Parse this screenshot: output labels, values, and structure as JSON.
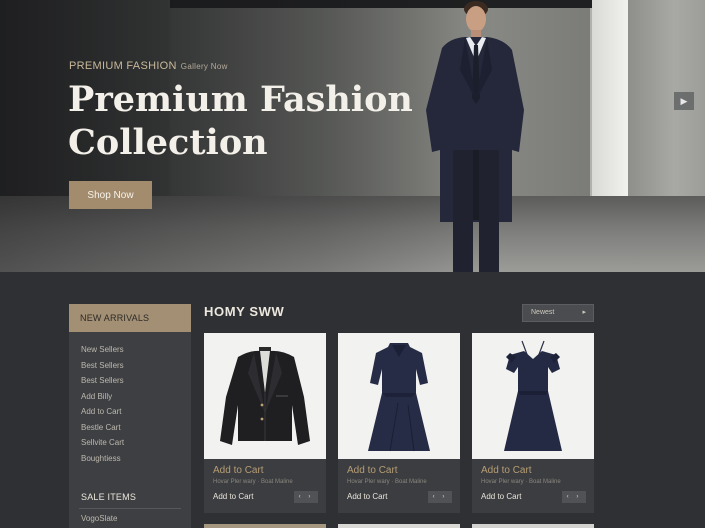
{
  "hero": {
    "eyebrow": "PREMIUM FASHION",
    "eyebrow_sub": "Gallery Now",
    "title_line1": "Premium Fashion",
    "title_line2": "Collection",
    "cta_label": "Shop Now",
    "next_icon": "chevron-right-icon"
  },
  "sidebar": {
    "heading": "NEW ARRIVALS",
    "items": [
      "New Sellers",
      "Best Sellers",
      "Best Sellers",
      "Add Billy",
      "Add to Cart",
      "Bestle Cart",
      "Sellvite Cart",
      "Boughtiess"
    ],
    "sale_heading": "SALE ITEMS",
    "sale_item": "VogoSlate"
  },
  "products": {
    "section_title": "HOMY SWW",
    "sort_label": "Newest",
    "items": [
      {
        "name": "leather-jacket",
        "cart_label": "Add to Cart",
        "tagline": "Hovar Pler wary · Boat Maline",
        "add_label": "Add to Cart",
        "nav": "‹ ›"
      },
      {
        "name": "navy-dress",
        "cart_label": "Add to Cart",
        "tagline": "Hovar Pler wary · Boat Maline",
        "add_label": "Add to Cart",
        "nav": "‹ ›"
      },
      {
        "name": "cold-shoulder-dress",
        "cart_label": "Add to Cart",
        "tagline": "Hovar Pler wary · Boat Maline",
        "add_label": "Add to Cart",
        "nav": "‹ ›"
      }
    ]
  },
  "colors": {
    "accent": "#a28c6d",
    "background": "#2f3033",
    "panel": "#3d3f42"
  }
}
